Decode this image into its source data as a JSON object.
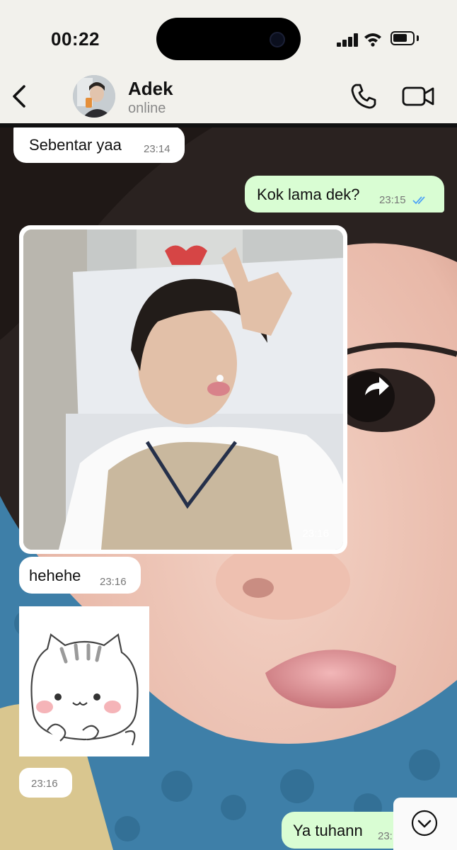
{
  "status_bar": {
    "time": "00:22",
    "signal_icon": "cellular-signal-icon",
    "wifi_icon": "wifi-icon",
    "battery_icon": "battery-icon",
    "battery_level": 0.75
  },
  "header": {
    "back_icon": "chevron-left-icon",
    "contact_name": "Adek",
    "contact_status": "online",
    "call_icon": "phone-icon",
    "video_icon": "video-camera-icon"
  },
  "messages": [
    {
      "direction": "incoming",
      "type": "text",
      "text": "Sebentar yaa",
      "time": "23:14"
    },
    {
      "direction": "outgoing",
      "type": "text",
      "text": "Kok lama dek?",
      "time": "23:15",
      "read": true
    },
    {
      "direction": "incoming",
      "type": "image",
      "time": "23:16"
    },
    {
      "direction": "incoming",
      "type": "text",
      "text": "hehehe",
      "time": "23:16"
    },
    {
      "direction": "incoming",
      "type": "sticker",
      "time": "23:16"
    },
    {
      "direction": "outgoing",
      "type": "text",
      "text": "Ya tuhann",
      "time": "23:"
    }
  ],
  "forward_icon": "forward-arrow-icon",
  "scroll_down_icon": "chevron-down-circle-icon",
  "colors": {
    "outgoing_bubble": "#d9fdd3",
    "incoming_bubble": "#ffffff",
    "read_ticks": "#4fa3f7",
    "header_bg": "#f2f1ec"
  }
}
